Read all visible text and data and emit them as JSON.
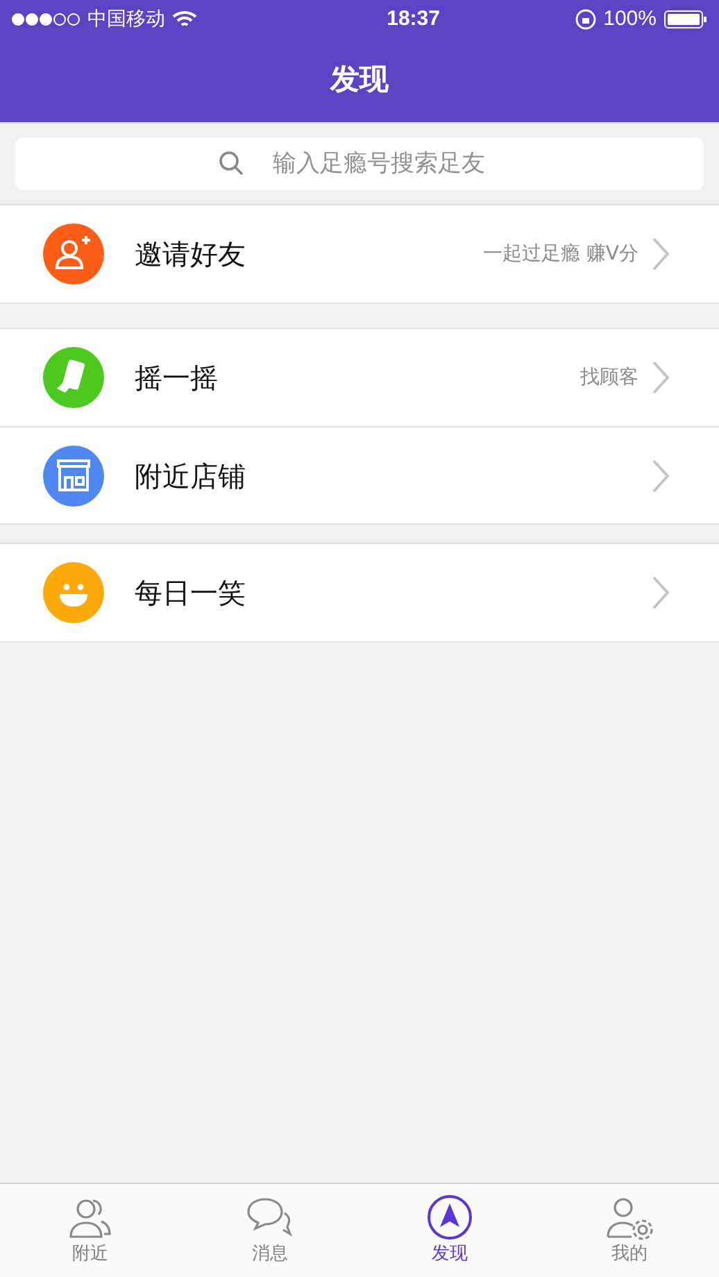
{
  "status_bar": {
    "carrier": "中国移动",
    "time": "18:37",
    "battery": "100%"
  },
  "nav": {
    "title": "发现"
  },
  "search": {
    "placeholder": "输入足瘾号搜索足友"
  },
  "groups": [
    {
      "items": [
        {
          "kind": "invite",
          "color": "#fd5d17",
          "label": "邀请好友",
          "detail": "一起过足瘾 赚V分"
        }
      ]
    },
    {
      "items": [
        {
          "kind": "shake",
          "color": "#4cc81f",
          "label": "摇一摇",
          "detail": "找顾客"
        },
        {
          "kind": "shop",
          "color": "#5188f0",
          "label": "附近店铺"
        }
      ]
    },
    {
      "items": [
        {
          "kind": "smile",
          "color": "#fcaa0b",
          "label": "每日一笑"
        }
      ]
    }
  ],
  "tabs": [
    {
      "kind": "people",
      "label": "附近",
      "selected": false
    },
    {
      "kind": "chat",
      "label": "消息",
      "selected": false
    },
    {
      "kind": "compass",
      "label": "发现",
      "selected": true
    },
    {
      "kind": "profile",
      "label": "我的",
      "selected": false
    }
  ]
}
